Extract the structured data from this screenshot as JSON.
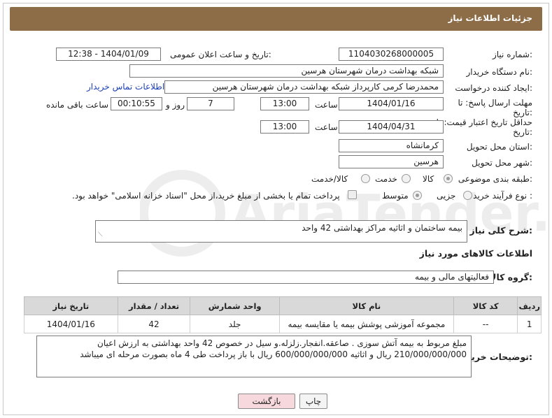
{
  "header": {
    "title": "جزئیات اطلاعات نیاز"
  },
  "watermark": {
    "brand": "AriaTender.neT"
  },
  "form": {
    "need_number_label": "شماره نیاز:",
    "need_number": "1104030268000005",
    "announce_label": "تاریخ و ساعت اعلان عمومی:",
    "announce_value": "1404/01/09 - 12:38",
    "buyer_org_label": "نام دستگاه خریدار:",
    "buyer_org": "شبکه بهداشت درمان شهرستان هرسین",
    "requester_label": "ایجاد کننده درخواست:",
    "requester": "محمدرضا کرمی کارپرداز شبکه بهداشت درمان شهرستان هرسین",
    "contact_link": "اطلاعات تماس خریدار",
    "deadline_label_1": "مهلت ارسال پاسخ: تا",
    "deadline_label_2": "تاریخ:",
    "deadline_date": "1404/01/16",
    "hour_label": "ساعت",
    "deadline_time": "13:00",
    "days_value": "7",
    "days_label": "روز و",
    "remaining_value": "00:10:55",
    "remaining_label": "ساعت باقی مانده",
    "validity_label_1": "حداقل تاریخ اعتبار قیمت: تا",
    "validity_label_2": "تاریخ:",
    "validity_date": "1404/04/31",
    "validity_time": "13:00",
    "province_label": "استان محل تحویل:",
    "province": "کرمانشاه",
    "city_label": "شهر محل تحویل:",
    "city": "هرسین",
    "category_label": "طبقه بندی موضوعی:",
    "category_options": [
      "کالا",
      "خدمت",
      "کالا/خدمت"
    ],
    "process_label": "نوع فرآیند خرید :",
    "process_options": [
      "جزیی",
      "متوسط"
    ],
    "payment_note": "پرداخت تمام یا بخشی از مبلغ خرید،از محل \"اسناد خزانه اسلامی\" خواهد بود.",
    "description_label": "شرح کلی نیاز:",
    "description": "بیمه ساختمان و اثاثیه مراکز بهداشتی 42 واحد",
    "goods_info_title": "اطلاعات کالاهای مورد نیاز",
    "goods_group_label": "گروه کالا:",
    "goods_group": "فعالیتهای مالی و بیمه"
  },
  "table": {
    "headers": [
      "ردیف",
      "کد کالا",
      "نام کالا",
      "واحد شمارش",
      "تعداد / مقدار",
      "تاریخ نیاز"
    ],
    "rows": [
      [
        "1",
        "--",
        "مجموعه آموزشی پوشش بیمه یا مقایسه بیمه",
        "جلد",
        "42",
        "1404/01/16"
      ]
    ]
  },
  "buyer_notes": {
    "label": "توضیحات خریدار:",
    "text": "مبلغ مربوط به بیمه آتش سوزی . صاعقه.انفجار.زلزله.و سیل در خصوص 42 واحد بهداشتی به ارزش اعیان 210/000/000/000 ریال و اثاثیه 600/000/000/000 ریال با باز پرداخت طی 4 ماه بصورت مرحله ای میباشد"
  },
  "buttons": {
    "back": "بازگشت",
    "print": "چاپ"
  },
  "colors": {
    "header": "#8c6d47",
    "table_header": "#d9d9d9",
    "back_button": "#f7d8dc",
    "link": "#1a3fb5"
  }
}
